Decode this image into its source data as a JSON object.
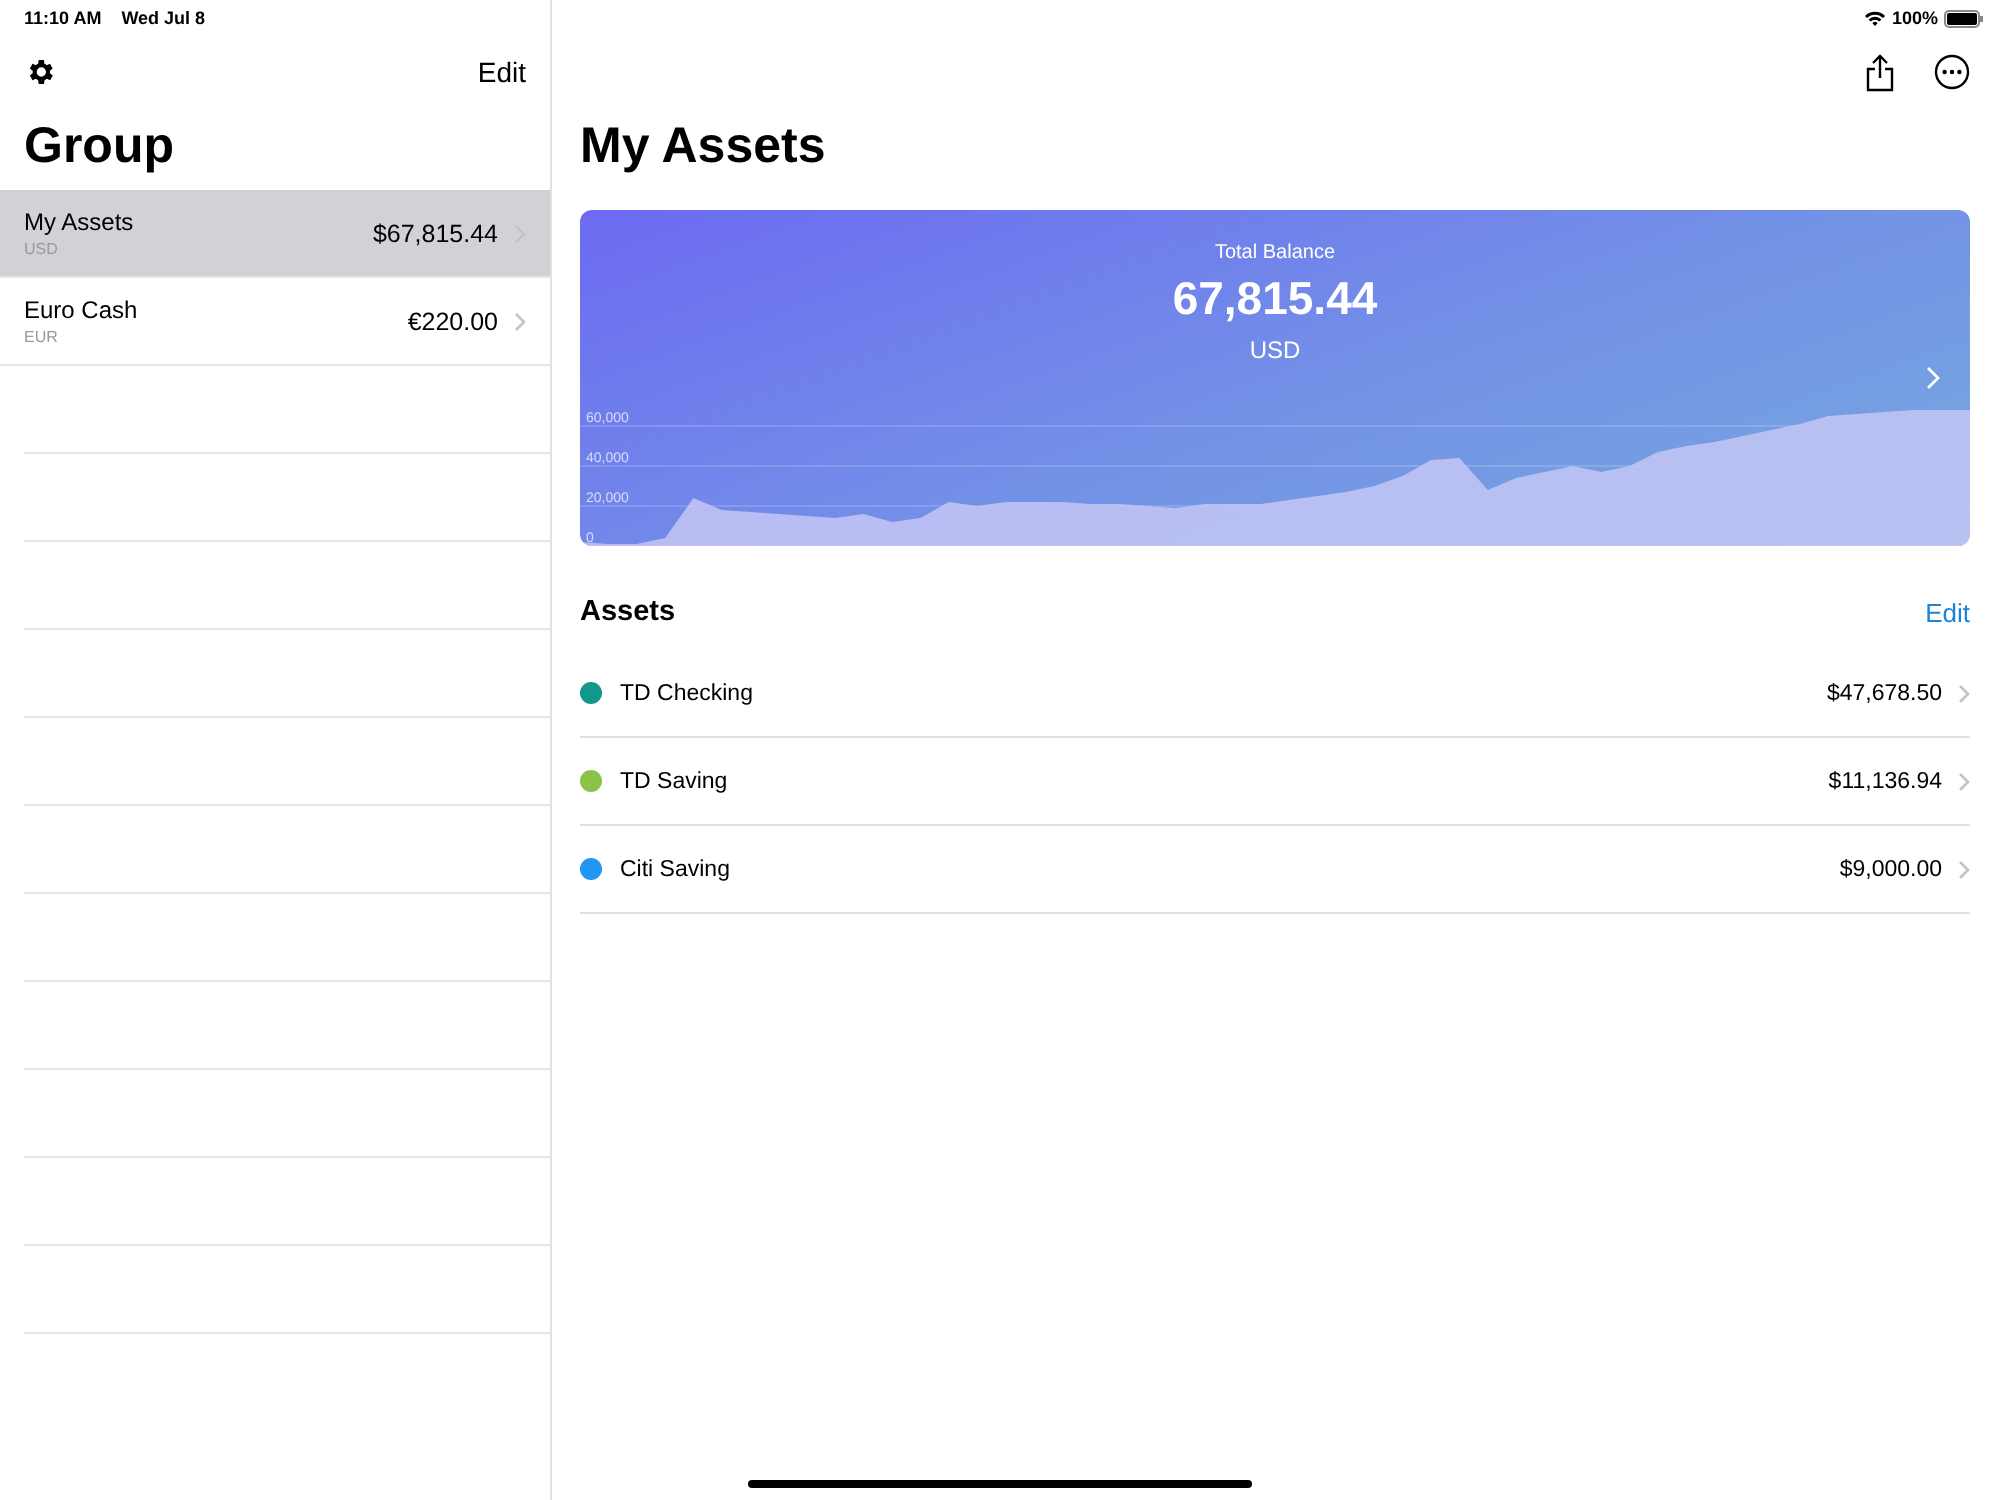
{
  "status_bar": {
    "time": "11:10 AM",
    "date": "Wed Jul 8",
    "battery": "100%"
  },
  "sidebar": {
    "edit": "Edit",
    "title": "Group",
    "groups": [
      {
        "name": "My Assets",
        "currency": "USD",
        "amount": "$67,815.44",
        "selected": true
      },
      {
        "name": "Euro Cash",
        "currency": "EUR",
        "amount": "€220.00",
        "selected": false
      }
    ]
  },
  "main": {
    "title": "My Assets",
    "balance_card": {
      "label": "Total Balance",
      "amount": "67,815.44",
      "currency": "USD",
      "chart_data": {
        "type": "area",
        "grid": true,
        "ylim": [
          0,
          168000
        ],
        "yticks": [
          {
            "value": 0,
            "label": "0"
          },
          {
            "value": 20000,
            "label": "20,000"
          },
          {
            "value": 40000,
            "label": "40,000"
          },
          {
            "value": 60000,
            "label": "60,000"
          }
        ],
        "series": [
          {
            "color": "#c4c6f5",
            "values": [
              2000,
              1000,
              1000,
              4000,
              24000,
              18000,
              17000,
              16000,
              15000,
              14000,
              16000,
              12000,
              14000,
              22000,
              20000,
              22000,
              22000,
              22000,
              21000,
              21000,
              20000,
              19000,
              21000,
              21000,
              21000,
              23000,
              25000,
              27000,
              30000,
              35000,
              43000,
              44000,
              28000,
              34000,
              37000,
              40000,
              37000,
              40000,
              47000,
              50000,
              52000,
              55000,
              58000,
              61000,
              65000,
              66000,
              67000,
              68000,
              68000,
              68000
            ]
          }
        ]
      }
    },
    "assets_section": {
      "title": "Assets",
      "edit": "Edit",
      "assets": [
        {
          "name": "TD Checking",
          "amount": "$47,678.50",
          "color": "#12978a"
        },
        {
          "name": "TD Saving",
          "amount": "$11,136.94",
          "color": "#8bc34a"
        },
        {
          "name": "Citi Saving",
          "amount": "$9,000.00",
          "color": "#2196f3"
        }
      ]
    }
  }
}
